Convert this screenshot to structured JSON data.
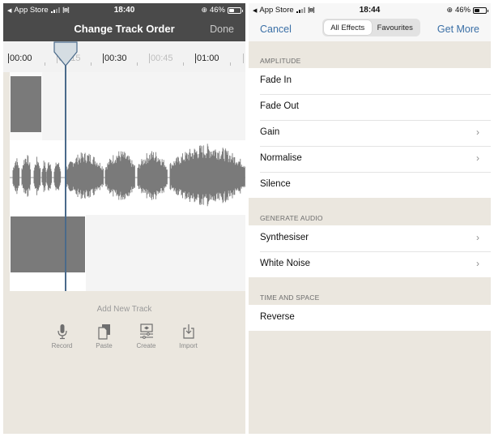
{
  "left_screen": {
    "status_bar": {
      "back_app": "App Store",
      "time": "18:40",
      "battery_percent": "46%",
      "battery_level": 0.46
    },
    "navbar": {
      "title": "Change Track Order",
      "done_label": "Done"
    },
    "ruler": {
      "labels": [
        {
          "text": "00:00",
          "dim": false
        },
        {
          "text": "00:15",
          "dim": true
        },
        {
          "text": "00:30",
          "dim": false
        },
        {
          "text": "00:45",
          "dim": true
        },
        {
          "text": "01:00",
          "dim": false
        }
      ]
    },
    "playhead_time": "00:15",
    "add_track": {
      "title": "Add New Track",
      "actions": [
        {
          "label": "Record",
          "icon": "microphone-icon"
        },
        {
          "label": "Paste",
          "icon": "paste-icon"
        },
        {
          "label": "Create",
          "icon": "create-icon"
        },
        {
          "label": "Import",
          "icon": "import-icon"
        }
      ]
    }
  },
  "right_screen": {
    "status_bar": {
      "back_app": "App Store",
      "time": "18:44",
      "battery_percent": "46%",
      "battery_level": 0.46
    },
    "navbar": {
      "cancel_label": "Cancel",
      "get_more_label": "Get More",
      "segments": [
        {
          "label": "All Effects",
          "active": true
        },
        {
          "label": "Favourites",
          "active": false
        }
      ]
    },
    "sections": [
      {
        "title": "AMPLITUDE",
        "items": [
          {
            "label": "Fade In",
            "has_chevron": false
          },
          {
            "label": "Fade Out",
            "has_chevron": false
          },
          {
            "label": "Gain",
            "has_chevron": true
          },
          {
            "label": "Normalise",
            "has_chevron": true
          },
          {
            "label": "Silence",
            "has_chevron": false
          }
        ]
      },
      {
        "title": "GENERATE AUDIO",
        "items": [
          {
            "label": "Synthesiser",
            "has_chevron": true
          },
          {
            "label": "White Noise",
            "has_chevron": true
          }
        ]
      },
      {
        "title": "TIME AND SPACE",
        "items": [
          {
            "label": "Reverse",
            "has_chevron": false
          }
        ]
      }
    ]
  },
  "colors": {
    "dark_bar": "#4a4a4a",
    "accent_blue": "#3a6fa6",
    "panel_beige": "#ebe7df",
    "clip_gray": "#7a7a7a",
    "playhead": "#4a6a8a"
  }
}
